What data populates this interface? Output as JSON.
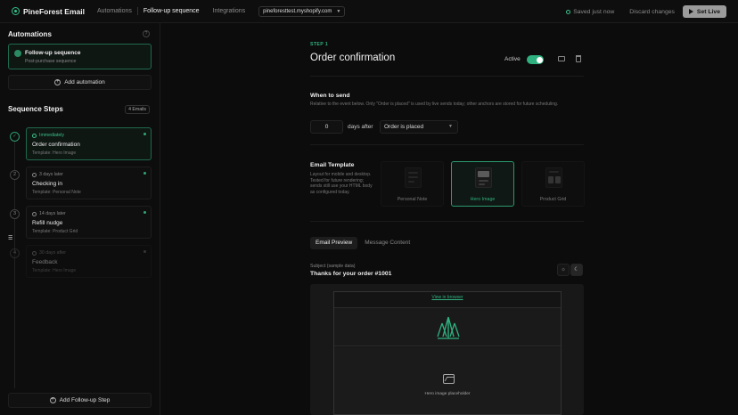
{
  "topbar": {
    "brand": "PineForest Email",
    "nav": [
      "Automations",
      "Follow-up sequence",
      "Integrations"
    ],
    "store": "pineforesttest.myshopify.com",
    "saved": "Saved just now",
    "discard": "Discard changes",
    "golive": "Set Live"
  },
  "sidebar": {
    "automations_title": "Automations",
    "help": "?",
    "automation": {
      "title": "Follow-up sequence",
      "subtitle": "Post-purchase sequence"
    },
    "add_automation": "Add automation",
    "steps_title": "Sequence Steps",
    "emails_badge": "4 Emails",
    "steps": [
      {
        "node": "✓",
        "when": "Immediately",
        "name": "Order confirmation",
        "template": "Template: Hero Image"
      },
      {
        "node": "2",
        "when": "3 days later",
        "name": "Checking in",
        "template": "Template: Personal Note"
      },
      {
        "node": "3",
        "when": "14 days later",
        "name": "Refill nudge",
        "template": "Template: Product Grid"
      },
      {
        "node": "4",
        "when": "30 days after",
        "name": "Feedback",
        "template": "Template: Hero Image"
      }
    ],
    "add_step": "Add Follow-up Step"
  },
  "main": {
    "step_label": "STEP 1",
    "title": "Order confirmation",
    "active_label": "Active",
    "active": true,
    "when_title": "When to send",
    "when_desc": "Relative to the event below. Only \"Order is placed\" is used by live sends today; other anchors are stored for future scheduling.",
    "days_value": "0",
    "days_after": "days after",
    "event": "Order is placed",
    "template_title": "Email Template",
    "template_desc": "Layout for mobile and desktop. Tested for future rendering; sends still use your HTML body as configured today.",
    "templates": [
      "Personal Note",
      "Hero Image",
      "Product Grid"
    ],
    "selected_template": "Hero Image",
    "tabs": [
      "Email Preview",
      "Message Content"
    ],
    "subject_label": "Subject (sample data)",
    "subject": "Thanks for your order #1001",
    "view_in_browser": "View in browser",
    "hero_placeholder": "Hero image placeholder"
  },
  "colors": {
    "accent": "#2fb07f",
    "background": "#0c0c0c"
  }
}
